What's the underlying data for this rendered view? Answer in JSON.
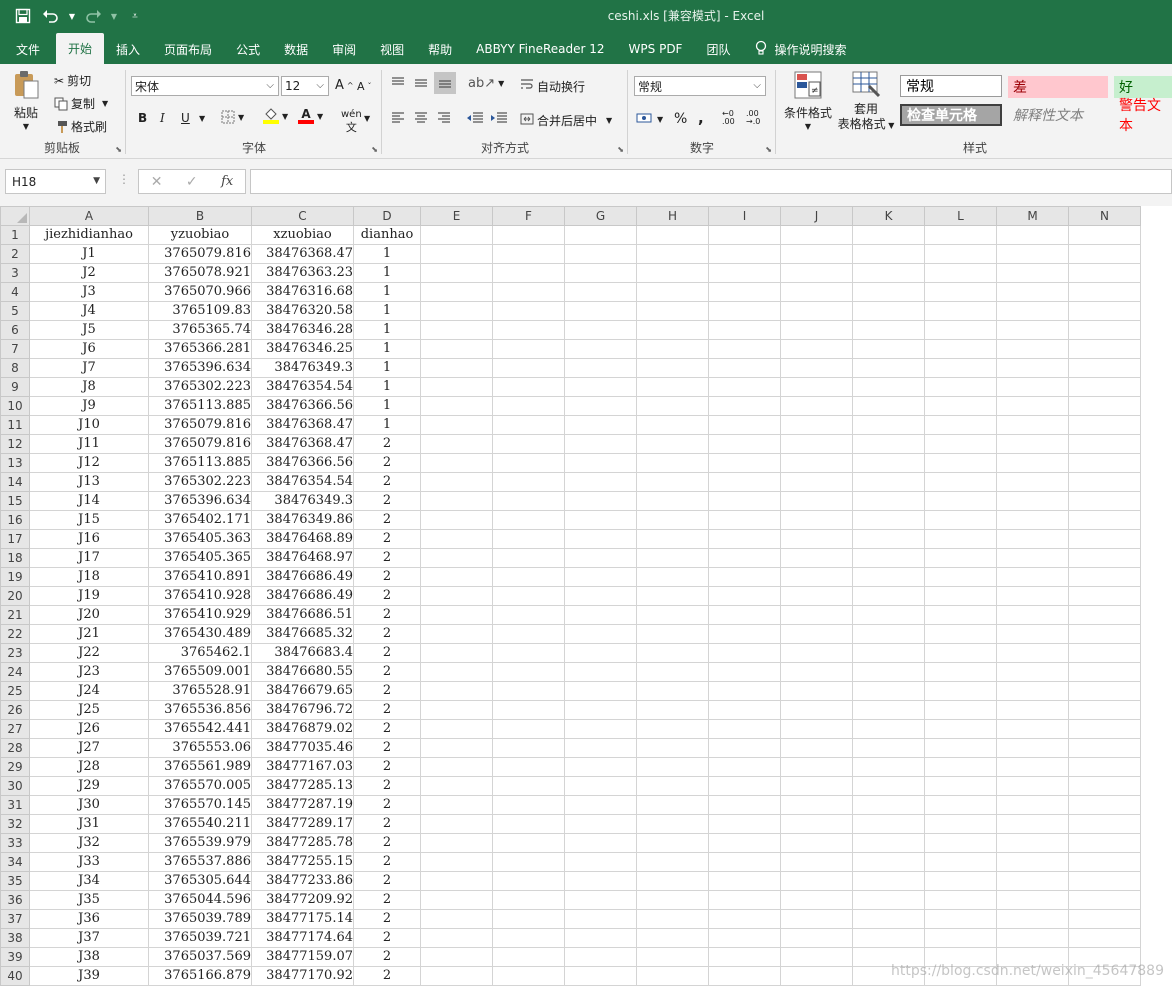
{
  "window": {
    "title": "ceshi.xls  [兼容模式]  -  Excel",
    "qat_icons": [
      "save-icon",
      "undo-icon",
      "redo-icon",
      "customize-qat-icon"
    ]
  },
  "tabs": [
    {
      "label": "文件"
    },
    {
      "label": "开始",
      "active": true
    },
    {
      "label": "插入"
    },
    {
      "label": "页面布局"
    },
    {
      "label": "公式"
    },
    {
      "label": "数据"
    },
    {
      "label": "审阅"
    },
    {
      "label": "视图"
    },
    {
      "label": "帮助"
    },
    {
      "label": "ABBYY FineReader 12"
    },
    {
      "label": "WPS PDF"
    },
    {
      "label": "团队"
    }
  ],
  "tell_me": "操作说明搜索",
  "ribbon": {
    "clipboard": {
      "label": "剪贴板",
      "paste": "粘贴",
      "cut": "剪切",
      "copy": "复制",
      "format_painter": "格式刷"
    },
    "font": {
      "label": "字体",
      "name": "宋体",
      "size": "12",
      "bold": "B",
      "italic": "I",
      "underline": "U",
      "grow": "A",
      "shrink": "A",
      "phonetic": "wén",
      "fill_color": "#ffff00",
      "font_color": "#ff0000"
    },
    "alignment": {
      "label": "对齐方式",
      "wrap": "自动换行",
      "merge": "合并后居中"
    },
    "number": {
      "label": "数字",
      "format": "常规",
      "percent": "%",
      "comma": ","
    },
    "styles": {
      "label": "样式",
      "conditional": "条件格式",
      "table_format_1": "套用",
      "table_format_2": "表格格式",
      "cells": [
        {
          "text": "常规",
          "bg": "#ffffff",
          "fg": "#000000"
        },
        {
          "text": "差",
          "bg": "#ffc7ce",
          "fg": "#9c0006"
        },
        {
          "text": "好",
          "bg": "#c6efce",
          "fg": "#006100"
        },
        {
          "text": "检查单元格",
          "bg": "#a5a5a5",
          "fg": "#ffffff"
        },
        {
          "text": "解释性文本",
          "bg": "#f3f3f3",
          "fg": "#7f7f7f"
        },
        {
          "text": "警告文本",
          "bg": "#f3f3f3",
          "fg": "#ff0000"
        }
      ]
    }
  },
  "formula_bar": {
    "name_box": "H18",
    "fx": "fx",
    "formula": ""
  },
  "sheet": {
    "columns": [
      "A",
      "B",
      "C",
      "D",
      "E",
      "F",
      "G",
      "H",
      "I",
      "J",
      "K",
      "L",
      "M",
      "N"
    ],
    "headers": [
      "jiezhidianhao",
      "yzuobiao",
      "xzuobiao",
      "dianhao"
    ],
    "rows": [
      [
        "J1",
        "3765079.816",
        "38476368.47",
        "1"
      ],
      [
        "J2",
        "3765078.921",
        "38476363.23",
        "1"
      ],
      [
        "J3",
        "3765070.966",
        "38476316.68",
        "1"
      ],
      [
        "J4",
        "3765109.83",
        "38476320.58",
        "1"
      ],
      [
        "J5",
        "3765365.74",
        "38476346.28",
        "1"
      ],
      [
        "J6",
        "3765366.281",
        "38476346.25",
        "1"
      ],
      [
        "J7",
        "3765396.634",
        "38476349.3",
        "1"
      ],
      [
        "J8",
        "3765302.223",
        "38476354.54",
        "1"
      ],
      [
        "J9",
        "3765113.885",
        "38476366.56",
        "1"
      ],
      [
        "J10",
        "3765079.816",
        "38476368.47",
        "1"
      ],
      [
        "J11",
        "3765079.816",
        "38476368.47",
        "2"
      ],
      [
        "J12",
        "3765113.885",
        "38476366.56",
        "2"
      ],
      [
        "J13",
        "3765302.223",
        "38476354.54",
        "2"
      ],
      [
        "J14",
        "3765396.634",
        "38476349.3",
        "2"
      ],
      [
        "J15",
        "3765402.171",
        "38476349.86",
        "2"
      ],
      [
        "J16",
        "3765405.363",
        "38476468.89",
        "2"
      ],
      [
        "J17",
        "3765405.365",
        "38476468.97",
        "2"
      ],
      [
        "J18",
        "3765410.891",
        "38476686.49",
        "2"
      ],
      [
        "J19",
        "3765410.928",
        "38476686.49",
        "2"
      ],
      [
        "J20",
        "3765410.929",
        "38476686.51",
        "2"
      ],
      [
        "J21",
        "3765430.489",
        "38476685.32",
        "2"
      ],
      [
        "J22",
        "3765462.1",
        "38476683.4",
        "2"
      ],
      [
        "J23",
        "3765509.001",
        "38476680.55",
        "2"
      ],
      [
        "J24",
        "3765528.91",
        "38476679.65",
        "2"
      ],
      [
        "J25",
        "3765536.856",
        "38476796.72",
        "2"
      ],
      [
        "J26",
        "3765542.441",
        "38476879.02",
        "2"
      ],
      [
        "J27",
        "3765553.06",
        "38477035.46",
        "2"
      ],
      [
        "J28",
        "3765561.989",
        "38477167.03",
        "2"
      ],
      [
        "J29",
        "3765570.005",
        "38477285.13",
        "2"
      ],
      [
        "J30",
        "3765570.145",
        "38477287.19",
        "2"
      ],
      [
        "J31",
        "3765540.211",
        "38477289.17",
        "2"
      ],
      [
        "J32",
        "3765539.979",
        "38477285.78",
        "2"
      ],
      [
        "J33",
        "3765537.886",
        "38477255.15",
        "2"
      ],
      [
        "J34",
        "3765305.644",
        "38477233.86",
        "2"
      ],
      [
        "J35",
        "3765044.596",
        "38477209.92",
        "2"
      ],
      [
        "J36",
        "3765039.789",
        "38477175.14",
        "2"
      ],
      [
        "J37",
        "3765039.721",
        "38477174.64",
        "2"
      ],
      [
        "J38",
        "3765037.569",
        "38477159.07",
        "2"
      ],
      [
        "J39",
        "3765166.879",
        "38477170.92",
        "2"
      ]
    ]
  },
  "watermark": "https://blog.csdn.net/weixin_45647889"
}
